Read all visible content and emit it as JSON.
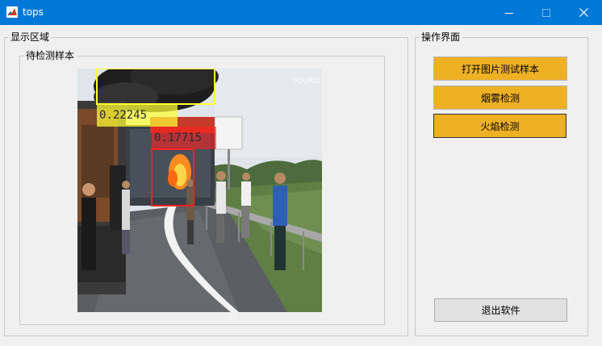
{
  "window": {
    "title": "tops",
    "icon": "matlab-icon",
    "controls": [
      "minimize-icon",
      "maximize-icon",
      "close-icon"
    ]
  },
  "display_panel": {
    "title": "显示区域",
    "sample_panel": {
      "title": "待检测样本",
      "image": "highway-truck-fire-scene",
      "detections": [
        {
          "score": "0.22245",
          "type": "smoke",
          "color": "#ffff33"
        },
        {
          "score": "0.17715",
          "type": "fire",
          "color": "#ff2020"
        }
      ],
      "watermark": "YOUKU"
    }
  },
  "operation_panel": {
    "title": "操作界面",
    "buttons": {
      "open_image": "打开图片测试样本",
      "smoke_detect": "烟雾检测",
      "fire_detect": "火焰检测",
      "exit": "退出软件"
    }
  },
  "colors": {
    "titlebar": "#0078d7",
    "button_accent": "#eeb124",
    "button_gray": "#e1e1e1"
  }
}
